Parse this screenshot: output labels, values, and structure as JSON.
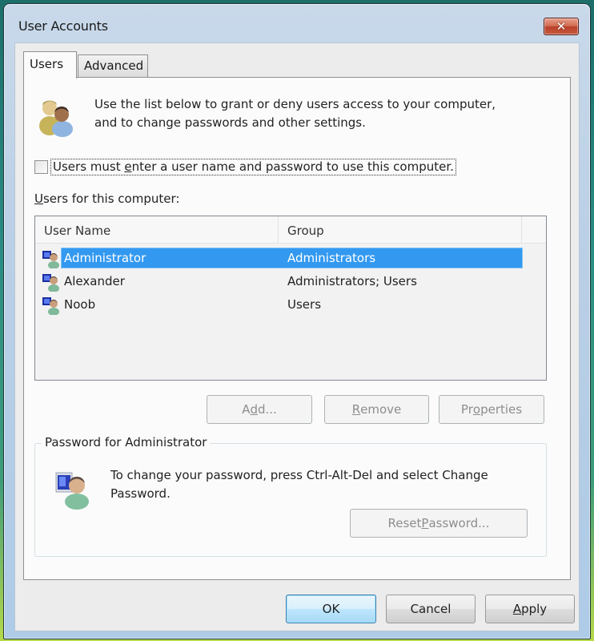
{
  "window": {
    "title": "User Accounts",
    "close_label": "✕"
  },
  "tabs": [
    {
      "label": "Users",
      "active": true
    },
    {
      "label": "Advanced",
      "active": false
    }
  ],
  "intro": {
    "icon": "users-group-icon",
    "text_line1": "Use the list below to grant or deny users access to your computer,",
    "text_line2": "and to change passwords and other settings."
  },
  "require_login": {
    "checked": false,
    "label_pre": "Users must ",
    "label_accel": "e",
    "label_post": "nter a user name and password to use this computer."
  },
  "users_list": {
    "label_accel": "U",
    "label_rest": "sers for this computer:",
    "columns": [
      "User Name",
      "Group"
    ],
    "rows": [
      {
        "name": "Administrator",
        "group": "Administrators",
        "selected": true,
        "icon": "user-account-icon"
      },
      {
        "name": "Alexander",
        "group": "Administrators; Users",
        "selected": false,
        "icon": "user-account-icon"
      },
      {
        "name": "Noob",
        "group": "Users",
        "selected": false,
        "icon": "user-account-icon"
      }
    ]
  },
  "list_buttons": {
    "add": {
      "pre": "A",
      "accel": "d",
      "post": "d...",
      "enabled": false
    },
    "remove": {
      "pre": "",
      "accel": "R",
      "post": "emove",
      "enabled": false
    },
    "properties": {
      "pre": "Pr",
      "accel": "o",
      "post": "perties",
      "enabled": false
    }
  },
  "password_group": {
    "title": "Password for Administrator",
    "icon": "user-computer-icon",
    "text_line1": "To change your password, press Ctrl-Alt-Del and select Change",
    "text_line2": "Password.",
    "reset_button": {
      "pre": "Reset ",
      "accel": "P",
      "post": "assword...",
      "enabled": false
    }
  },
  "footer": {
    "ok_label": "OK",
    "cancel_label": "Cancel",
    "apply": {
      "pre": "",
      "accel": "A",
      "post": "pply"
    }
  },
  "colors": {
    "selection": "#3399f0",
    "close_button": "#c9583c",
    "window_frame": "#b9cfe6",
    "client_bg": "#ececec"
  }
}
